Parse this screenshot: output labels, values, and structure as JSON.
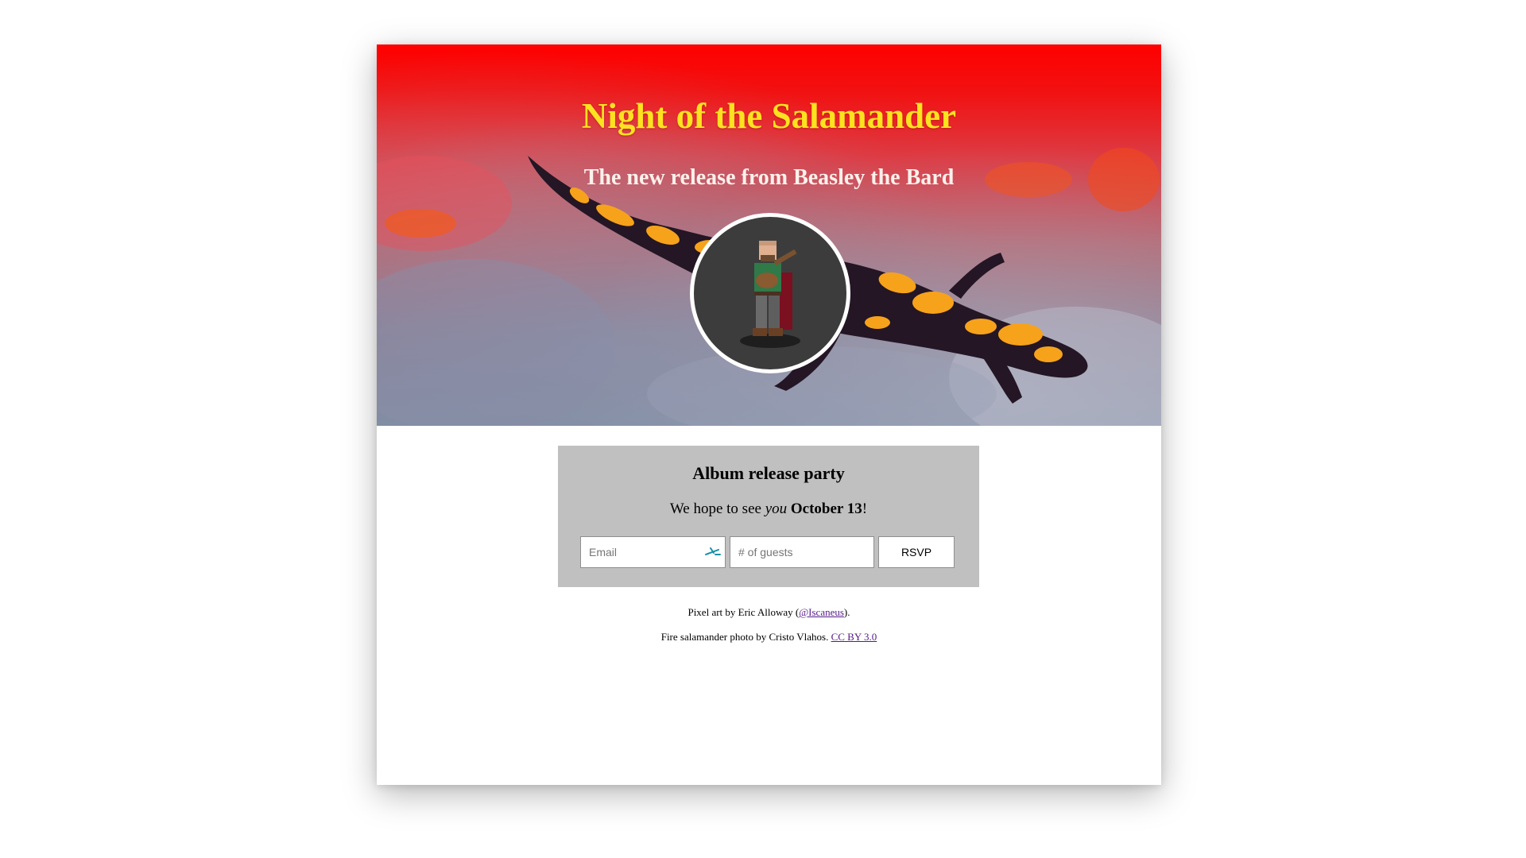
{
  "hero": {
    "title": "Night of the Salamander",
    "subtitle": "The new release from Beasley the Bard",
    "avatar_icon": "bard-pixel-art-icon",
    "colors": {
      "title": "#ffe21f",
      "subtitle": "#fff1ec",
      "overlay": "#ff0000",
      "salamander_body": "#241624",
      "salamander_spots": "#f7a21b"
    }
  },
  "rsvp": {
    "heading": "Album release party",
    "text_before": "We hope to see ",
    "text_emphasis": "you",
    "text_between": " ",
    "text_date": "October 13",
    "text_after": "!",
    "email_placeholder": "Email",
    "guests_placeholder": "# of guests",
    "button_label": "RSVP",
    "autofill_icon": "password-autofill-icon",
    "card_color": "#c0c0c0"
  },
  "credits": {
    "pixel_art_prefix": "Pixel art by Eric Alloway (",
    "pixel_art_link": "@Iscaneus",
    "pixel_art_suffix": ").",
    "photo_prefix": "Fire salamander photo by Cristo Vlahos. ",
    "photo_link": "CC BY 3.0",
    "link_color": "#551a8b"
  }
}
